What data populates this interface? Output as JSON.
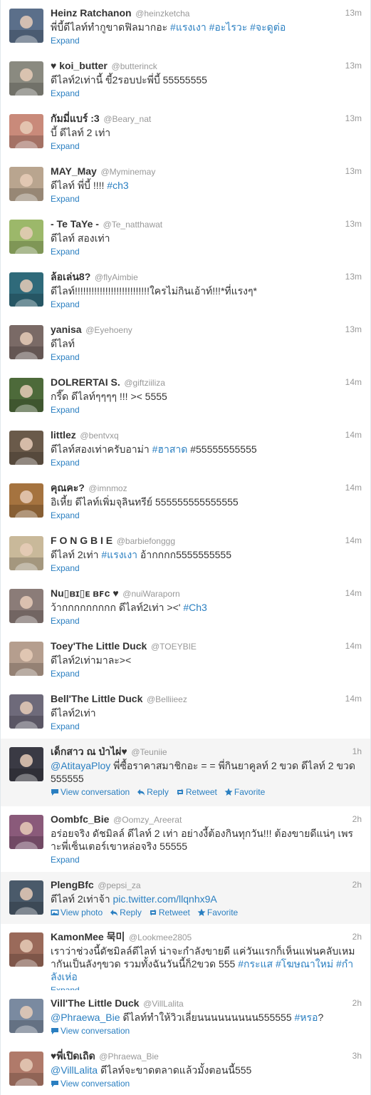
{
  "expand_label": "Expand",
  "view_conversation_label": "View conversation",
  "view_photo_label": "View photo",
  "reply_label": "Reply",
  "retweet_label": "Retweet",
  "favorite_label": "Favorite",
  "tweets": [
    {
      "name": "Heinz Ratchanon",
      "handle": "@heinzketcha",
      "time": "13m",
      "text": [
        {
          "t": "พี่บี้ดีไลท์ทำกูขาดฟิลมากอะ "
        },
        {
          "t": "#แรงเงา",
          "link": true
        },
        {
          "t": " "
        },
        {
          "t": "#อะไรวะ",
          "link": true
        },
        {
          "t": " "
        },
        {
          "t": "#จะดูต่อ",
          "link": true
        }
      ],
      "footer": "expand",
      "avatar": "#5b6f8a"
    },
    {
      "name": "♥ koi_butter",
      "handle": "@butterinck",
      "time": "13m",
      "text": [
        {
          "t": "ดีไลท์2เท่านี้ ขี้2รอบปะพี่บี้ 55555555"
        }
      ],
      "footer": "expand",
      "avatar": "#8a8a80"
    },
    {
      "name": "กัมมี่แบร์ :3",
      "handle": "@Beary_nat",
      "time": "13m",
      "text": [
        {
          "t": "บี้ ดีไลท์ 2 เท่า"
        }
      ],
      "footer": "expand",
      "avatar": "#c98a7a"
    },
    {
      "name": "MAY_May",
      "handle": "@Myminemay",
      "time": "13m",
      "text": [
        {
          "t": "ดีไลท์ พี่บี้ !!!! "
        },
        {
          "t": "#ch3",
          "link": true
        }
      ],
      "footer": "expand",
      "avatar": "#b9a58f"
    },
    {
      "name": "- Te TaYe -",
      "handle": "@Te_natthawat",
      "time": "13m",
      "text": [
        {
          "t": "ดีไลท์ สองเท่า"
        }
      ],
      "footer": "expand",
      "avatar": "#9cb86a"
    },
    {
      "name": "ล้อเล่น8?",
      "handle": "@flyAimbie",
      "time": "13m",
      "text": [
        {
          "t": "ดีไลท์!!!!!!!!!!!!!!!!!!!!!!!!!!!ใครไม่กินเอ้าท์!!!*ที่แรงๆ*"
        }
      ],
      "footer": "expand",
      "avatar": "#2f6a7a"
    },
    {
      "name": "yanisa",
      "handle": "@Eyehoeny",
      "time": "13m",
      "text": [
        {
          "t": "ดีไลท์"
        }
      ],
      "footer": "expand",
      "avatar": "#7a6a66"
    },
    {
      "name": "DOLRERTAI S.",
      "handle": "@giftziiliza",
      "time": "14m",
      "text": [
        {
          "t": "กรี๊ด ดีไลท์ๆๆๆๆ !!! >< 5555"
        }
      ],
      "footer": "expand",
      "avatar": "#4d6a3a"
    },
    {
      "name": "littlez",
      "handle": "@bentvxq",
      "time": "14m",
      "text": [
        {
          "t": "ดีไลท์สองเท่าครับอาม่า "
        },
        {
          "t": "#ฮาสาด",
          "link": true
        },
        {
          "t": " #55555555555"
        }
      ],
      "footer": "expand",
      "avatar": "#6a5a4a"
    },
    {
      "name": "คุณคะ?",
      "handle": "@imnmoz",
      "time": "14m",
      "text": [
        {
          "t": "อิเหี้ย ดีไลท์เพิ่มจุลินทรีย์ 555555555555555"
        }
      ],
      "footer": "expand",
      "avatar": "#a5733f"
    },
    {
      "name": "F O N G B I E",
      "handle": "@barbiefonggg",
      "time": "14m",
      "text": [
        {
          "t": "ดีไลท์ 2เท่า "
        },
        {
          "t": "#แรงเงา",
          "link": true
        },
        {
          "t": " อ้ากกกก5555555555"
        }
      ],
      "footer": "expand",
      "avatar": "#c9b99a"
    },
    {
      "name": "Nu▯ʙɪ▯ᴇ ʙꜰc ♥",
      "handle": "@nuiWaraporn",
      "time": "14m",
      "text": [
        {
          "t": "ว้ากกกกกกกกก ดีไลท์2เท่า ><' "
        },
        {
          "t": "#Ch3",
          "link": true
        }
      ],
      "footer": "expand",
      "avatar": "#8b7c78"
    },
    {
      "name": "Toey'The Little Duck",
      "handle": "@TOEYBIE",
      "time": "14m",
      "text": [
        {
          "t": "ดีไลท์2เท่ามาละ><"
        }
      ],
      "footer": "expand",
      "avatar": "#b59e8e"
    },
    {
      "name": "Bell'The Little Duck",
      "handle": "@Belliieez",
      "time": "14m",
      "text": [
        {
          "t": "ดีไลท์2เท่า"
        }
      ],
      "footer": "expand",
      "avatar": "#6e6a7a"
    },
    {
      "name": "เด็กสาว ณ ป่าไผ่♥",
      "handle": "@Teuniie",
      "time": "1h",
      "text": [
        {
          "t": "@AtitayaPloy",
          "link": true
        },
        {
          "t": " พี่ซื้อราคาสมาชิกอะ = = พี่กินยาคูลท์ 2 ขวด ดีไลท์ 2 ขวด 555555"
        }
      ],
      "footer": "conversation",
      "highlight": true,
      "avatar": "#3a3a44"
    },
    {
      "name": "Oombfc_Bie",
      "handle": "@Oomzy_Areerat",
      "time": "2h",
      "text": [
        {
          "t": "อร่อยจริง ดัชมิลล์ ดีไลท์ 2 เท่า อย่างงี้ต้องกินทุกวัน!!! ต้องขายดีแน่ๆ เพราะพี่เซ็นเตอร์เขาหล่อจริง 55555"
        }
      ],
      "footer": "expand",
      "avatar": "#8a5a7a"
    },
    {
      "name": "PlengBfc",
      "handle": "@pepsi_za",
      "time": "2h",
      "text": [
        {
          "t": "ดีไลท์ 2เท่าจ้า "
        },
        {
          "t": "pic.twitter.com/llqnhx9A",
          "link": true
        }
      ],
      "footer": "photo",
      "highlight": true,
      "avatar": "#4a5a6a"
    },
    {
      "name": "KamonMee 묵미",
      "handle": "@Lookmee2805",
      "time": "2h",
      "text": [
        {
          "t": "เราว่าช่วงนี้ดัชมิลล์ดีไลท์ น่าจะกำลังขายดี แค่วันแรกก็เห็นแฟนคลับเหมากันเป็นลังๆขวด รวมทั้งฉันวันนี้ก็2ขวด 555 "
        },
        {
          "t": "#กระแส",
          "link": true
        },
        {
          "t": " "
        },
        {
          "t": "#โฆษณาใหม่",
          "link": true
        },
        {
          "t": " "
        },
        {
          "t": "#กำลังเห่อ",
          "link": true
        }
      ],
      "footer": "expand",
      "avatar": "#9a6a5a"
    },
    {
      "name": "Vill'The Little Duck",
      "handle": "@VillLalita",
      "time": "2h",
      "text": [
        {
          "t": "@Phraewa_Bie",
          "link": true
        },
        {
          "t": " ดีไลท์ทำให้วิวเลี่ยนนนนนนนนน555555 "
        },
        {
          "t": "#หรอ",
          "link": true
        },
        {
          "t": "?"
        }
      ],
      "footer": "conversation",
      "avatar": "#7a8aa0"
    },
    {
      "name": "♥พี่เปิดเถิด",
      "handle": "@Phraewa_Bie",
      "time": "3h",
      "text": [
        {
          "t": "@VillLalita",
          "link": true
        },
        {
          "t": " ดีไลท์จะขาดตลาดแล้วมั้งตอนนี้555"
        }
      ],
      "footer": "conversation",
      "avatar": "#b07a6a"
    }
  ]
}
